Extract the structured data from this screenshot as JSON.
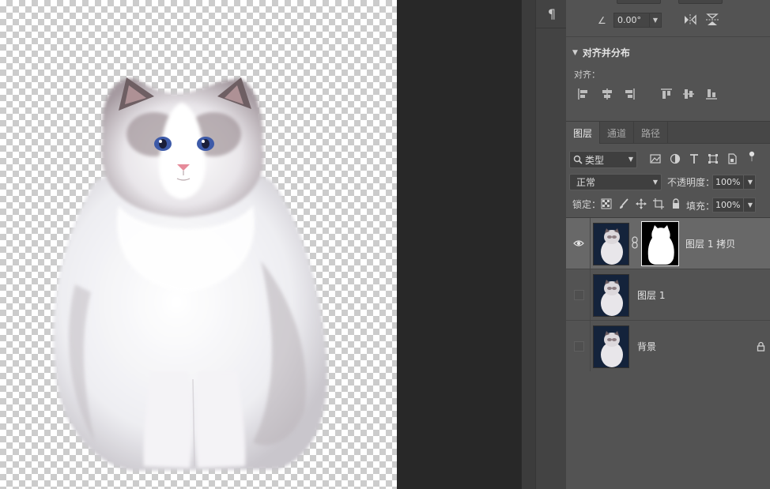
{
  "canvas": {
    "image_subject": "ragdoll-cat-cutout"
  },
  "dock": {
    "paragraph_icon": "¶"
  },
  "transform": {
    "angle_icon": "∠",
    "angle_value": "0.00°"
  },
  "align": {
    "title": "对齐并分布",
    "label": "对齐："
  },
  "layers_panel": {
    "tabs": [
      {
        "label": "图层",
        "active": true
      },
      {
        "label": "通道",
        "active": false
      },
      {
        "label": "路径",
        "active": false
      }
    ],
    "filter": {
      "label": "类型"
    },
    "blend_mode": "正常",
    "opacity_label": "不透明度：",
    "opacity_value": "100%",
    "lock_label": "锁定：",
    "fill_label": "填充：",
    "fill_value": "100%",
    "layers": [
      {
        "name": "图层 1 拷贝",
        "visible": true,
        "selected": true,
        "has_mask": true
      },
      {
        "name": "图层 1",
        "visible": false,
        "selected": false,
        "has_mask": false
      },
      {
        "name": "背景",
        "visible": false,
        "selected": false,
        "has_mask": false,
        "locked": true
      }
    ]
  },
  "colors": {
    "panel_bg": "#535353",
    "selected_layer": "#686868",
    "pasteboard": "#282828",
    "thumbnail_bg": "#14233b"
  }
}
